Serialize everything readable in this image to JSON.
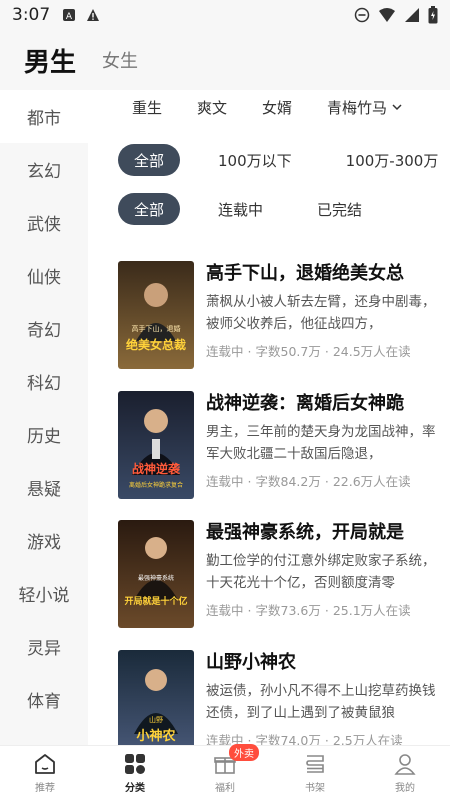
{
  "status_bar": {
    "time": "3:07"
  },
  "top_tabs": {
    "active": "男生",
    "other": "女生"
  },
  "sidebar": {
    "items": [
      {
        "label": "都市"
      },
      {
        "label": "玄幻"
      },
      {
        "label": "武侠"
      },
      {
        "label": "仙侠"
      },
      {
        "label": "奇幻"
      },
      {
        "label": "科幻"
      },
      {
        "label": "历史"
      },
      {
        "label": "悬疑"
      },
      {
        "label": "游戏"
      },
      {
        "label": "轻小说"
      },
      {
        "label": "灵异"
      },
      {
        "label": "体育"
      }
    ],
    "active_index": 0
  },
  "subcategories": [
    "重生",
    "爽文",
    "女婿",
    "青梅竹马"
  ],
  "word_filter": [
    "全部",
    "100万以下",
    "100万-300万"
  ],
  "status_filter": [
    "全部",
    "连载中",
    "已完结"
  ],
  "books": [
    {
      "title": "高手下山，退婚绝美女总",
      "desc": "萧枫从小被人斩去左臂，还身中剧毒，被师父收养后，他征战四方，",
      "status": "连载中",
      "words": "字数50.7万",
      "readers": "24.5万人在读",
      "cover_text": "绝美女总裁",
      "cover_top": "高手下山，退婚",
      "cover_colors": [
        "#3a2a1a",
        "#8a6a3a"
      ]
    },
    {
      "title": "战神逆袭：离婚后女神跪",
      "desc": "男主，三年前的楚天身为龙国战神，率军大败北疆二十敌国后隐退，",
      "status": "连载中",
      "words": "字数84.2万",
      "readers": "22.6万人在读",
      "cover_text": "战神逆袭",
      "cover_top": "离婚后女神跪求复合",
      "cover_colors": [
        "#1a1f2e",
        "#3a4a66"
      ]
    },
    {
      "title": "最强神豪系统，开局就是",
      "desc": "勤工俭学的付江意外绑定败家子系统，十天花光十个亿，否则额度清零",
      "status": "连载中",
      "words": "字数73.6万",
      "readers": "25.1万人在读",
      "cover_text": "开局就是十个亿",
      "cover_top": "最强神豪系统",
      "cover_colors": [
        "#2a1a10",
        "#6b4a2a"
      ]
    },
    {
      "title": "山野小神农",
      "desc": "被运债，孙小凡不得不上山挖草药换钱还债，到了山上遇到了被黄鼠狼",
      "status": "连载中",
      "words": "字数74.0万",
      "readers": "2.5万人在读",
      "cover_text": "小神农",
      "cover_top": "山野",
      "cover_colors": [
        "#1a2a3a",
        "#4a5a7a"
      ]
    }
  ],
  "bottom_nav": [
    {
      "label": "推荐",
      "icon": "home-icon"
    },
    {
      "label": "分类",
      "icon": "category-icon"
    },
    {
      "label": "福利",
      "icon": "gift-icon",
      "badge": "外卖"
    },
    {
      "label": "书架",
      "icon": "bookshelf-icon"
    },
    {
      "label": "我的",
      "icon": "profile-icon"
    }
  ],
  "colors": {
    "chip_active": "#3f4b5b",
    "badge": "#ff4d3d"
  }
}
